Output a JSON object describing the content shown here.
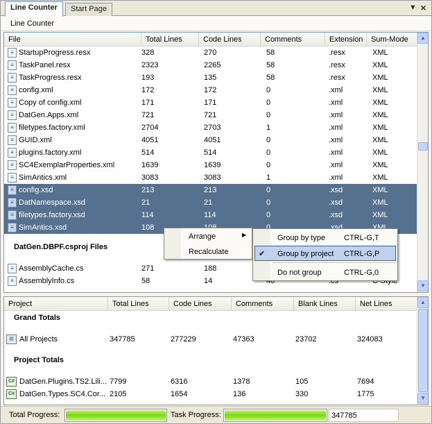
{
  "tabs": [
    {
      "label": "Line Counter",
      "active": true
    },
    {
      "label": "Start Page",
      "active": false
    }
  ],
  "window_controls": {
    "dropdown": "▼",
    "close": "×"
  },
  "subheader": "Line Counter",
  "file_list": {
    "columns": [
      "File",
      "Total Lines",
      "Code Lines",
      "Comments",
      "Extension",
      "Sum-Mode"
    ],
    "rows": [
      {
        "name": "StartupProgress.resx",
        "total": "328",
        "code": "270",
        "comments": "58",
        "ext": ".resx",
        "mode": "XML",
        "selected": false
      },
      {
        "name": "TaskPanel.resx",
        "total": "2323",
        "code": "2265",
        "comments": "58",
        "ext": ".resx",
        "mode": "XML",
        "selected": false
      },
      {
        "name": "TaskProgress.resx",
        "total": "193",
        "code": "135",
        "comments": "58",
        "ext": ".resx",
        "mode": "XML",
        "selected": false
      },
      {
        "name": "config.xml",
        "total": "172",
        "code": "172",
        "comments": "0",
        "ext": ".xml",
        "mode": "XML",
        "selected": false
      },
      {
        "name": "Copy of config.xml",
        "total": "171",
        "code": "171",
        "comments": "0",
        "ext": ".xml",
        "mode": "XML",
        "selected": false
      },
      {
        "name": "DatGen.Apps.xml",
        "total": "721",
        "code": "721",
        "comments": "0",
        "ext": ".xml",
        "mode": "XML",
        "selected": false
      },
      {
        "name": "filetypes.factory.xml",
        "total": "2704",
        "code": "2703",
        "comments": "1",
        "ext": ".xml",
        "mode": "XML",
        "selected": false
      },
      {
        "name": "GUID.xml",
        "total": "4051",
        "code": "4051",
        "comments": "0",
        "ext": ".xml",
        "mode": "XML",
        "selected": false
      },
      {
        "name": "plugins.factory.xml",
        "total": "514",
        "code": "514",
        "comments": "0",
        "ext": ".xml",
        "mode": "XML",
        "selected": false
      },
      {
        "name": "SC4ExemplarProperties.xml",
        "total": "1639",
        "code": "1639",
        "comments": "0",
        "ext": ".xml",
        "mode": "XML",
        "selected": false
      },
      {
        "name": "SimAntics.xml",
        "total": "3083",
        "code": "3083",
        "comments": "1",
        "ext": ".xml",
        "mode": "XML",
        "selected": false
      },
      {
        "name": "config.xsd",
        "total": "213",
        "code": "213",
        "comments": "0",
        "ext": ".xsd",
        "mode": "XML",
        "selected": true
      },
      {
        "name": "DatNamespace.xsd",
        "total": "21",
        "code": "21",
        "comments": "0",
        "ext": ".xsd",
        "mode": "XML",
        "selected": true
      },
      {
        "name": "filetypes.factory.xsd",
        "total": "114",
        "code": "114",
        "comments": "0",
        "ext": ".xsd",
        "mode": "XML",
        "selected": true
      },
      {
        "name": "SimAntics.xsd",
        "total": "108",
        "code": "108",
        "comments": "0",
        "ext": ".xsd",
        "mode": "XML",
        "selected": true
      }
    ],
    "group_title": "DatGen.DBPF.csproj Files",
    "group_rows": [
      {
        "name": "AssemblyCache.cs",
        "total": "271",
        "code": "188",
        "comments": "",
        "ext": "",
        "mode": "",
        "selected": false
      },
      {
        "name": "AssemblyInfo.cs",
        "total": "58",
        "code": "14",
        "comments": "40",
        "ext": ".cs",
        "mode": "C-Style",
        "selected": false
      }
    ]
  },
  "project_list": {
    "columns": [
      "Project",
      "Total Lines",
      "Code Lines",
      "Comments",
      "Blank Lines",
      "Net Lines"
    ],
    "grand_title": "Grand Totals",
    "grand_row": {
      "name": "All Projects",
      "total": "347785",
      "code": "277229",
      "comments": "47363",
      "blank": "23702",
      "net": "324083"
    },
    "project_title": "Project Totals",
    "project_rows": [
      {
        "name": "DatGen.Plugins.TS2.Lili...",
        "total": "7799",
        "code": "6316",
        "comments": "1378",
        "blank": "105",
        "net": "7694"
      },
      {
        "name": "DatGen.Types.SC4.Cor...",
        "total": "2105",
        "code": "1654",
        "comments": "136",
        "blank": "330",
        "net": "1775"
      }
    ]
  },
  "status": {
    "total_label": "Total Progress:",
    "total_progress": 1.0,
    "task_label": "Task Progress:",
    "task_progress": 1.0,
    "value": "347785"
  },
  "context_menu": {
    "items": [
      {
        "label": "Arrange",
        "submenu": true
      },
      {
        "label": "Recalculate",
        "submenu": false
      }
    ]
  },
  "submenu": {
    "items": [
      {
        "label": "Group by type",
        "shortcut": "CTRL-G,T",
        "checked": false
      },
      {
        "label": "Group by project",
        "shortcut": "CTRL-G,P",
        "checked": true
      },
      {
        "label": "Do not group",
        "shortcut": "CTRL-G,0",
        "checked": false
      }
    ],
    "arrow": "▶",
    "check": "✔"
  }
}
